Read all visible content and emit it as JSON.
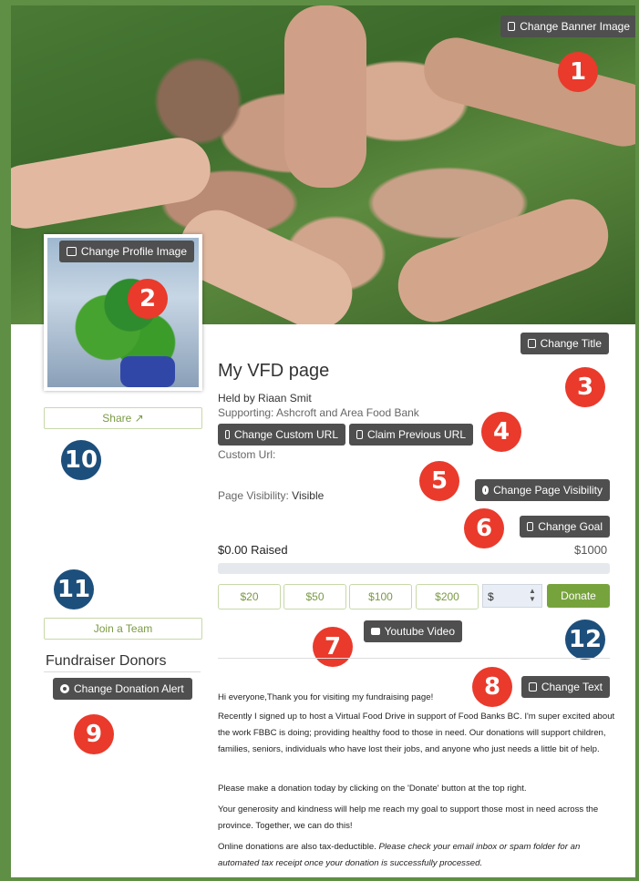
{
  "banner": {
    "change_label": "Change Banner Image"
  },
  "profile": {
    "change_label": "Change Profile Image"
  },
  "sidebar": {
    "share_label": "Share",
    "join_team_label": "Join a Team",
    "donors_title": "Fundraiser Donors",
    "change_alert_label": "Change Donation Alert"
  },
  "page": {
    "change_title_label": "Change Title",
    "title": "My VFD page",
    "held_by": "Held by Riaan Smit",
    "supporting": "Supporting: Ashcroft and Area Food Bank",
    "change_url_label": "Change Custom URL",
    "claim_url_label": "Claim Previous URL",
    "custom_url_label": "Custom Url:",
    "visibility_label": "Page Visibility:",
    "visibility_value": "Visible",
    "change_visibility_label": "Change Page Visibility",
    "change_goal_label": "Change Goal",
    "raised": "$0.00 Raised",
    "goal": "$1000",
    "progress_percent": 0
  },
  "donate": {
    "amounts": [
      "$20",
      "$50",
      "$100",
      "$200"
    ],
    "custom_prefix": "$",
    "donate_label": "Donate"
  },
  "video": {
    "label": "Youtube Video"
  },
  "description": {
    "change_text_label": "Change Text",
    "greeting": "Hi everyone,Thank you for visiting my fundraising page!",
    "p1": "Recently I signed up to host a Virtual Food Drive in support of Food Banks BC. I'm super excited about the work FBBC is doing; providing healthy food to those in need. Our donations will support children, families, seniors, individuals who have lost their jobs, and anyone who just needs a little bit of help.",
    "p2": "Please make a donation today by clicking on the 'Donate' button at the top right.",
    "p3": "Your generosity and kindness will help me reach my goal to support those most in need across the province. Together, we can do this!",
    "p4_plain": "Online donations are also tax-deductible. ",
    "p4_italic": "Please check your email inbox or spam folder for an automated tax receipt once your donation is successfully processed."
  },
  "callouts": [
    "1",
    "2",
    "3",
    "4",
    "5",
    "6",
    "7",
    "8",
    "9",
    "10",
    "11",
    "12"
  ],
  "colors": {
    "frame": "#5e8f45",
    "accent_green": "#77a33d",
    "badge_red": "#e93a2c",
    "badge_blue": "#1d4f7c",
    "button_dark": "#4f4f4f"
  }
}
